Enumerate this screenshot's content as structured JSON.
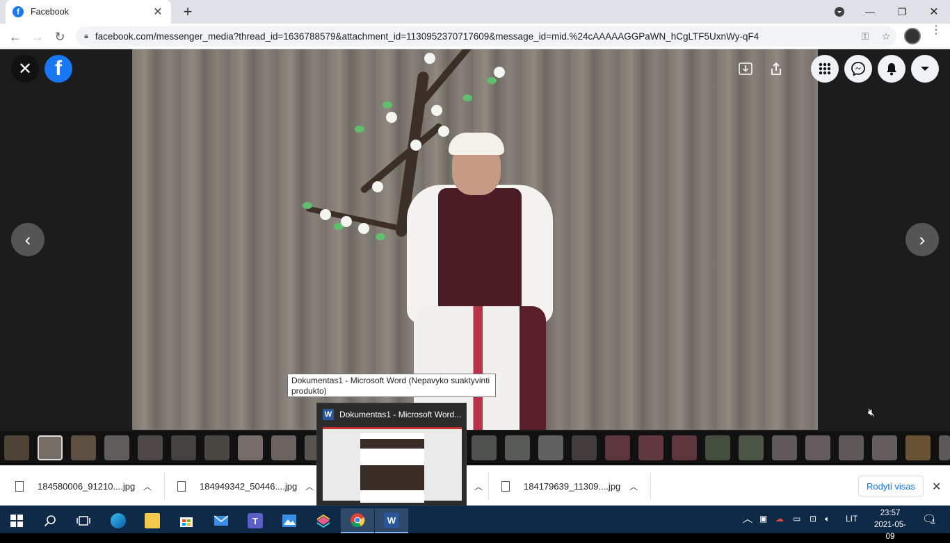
{
  "browser": {
    "tab_title": "Facebook",
    "tab_favicon": "f",
    "new_tab_symbol": "+",
    "url": "facebook.com/messenger_media?thread_id=1636788579&attachment_id=1130952370717609&message_id=mid.%24cAAAAAGGPaWN_hCgLTF5UxnWy-qF4"
  },
  "viewer": {
    "logo_letter": "f",
    "close_symbol": "✕",
    "prev_symbol": "‹",
    "next_symbol": "›"
  },
  "tooltip": {
    "text": "Dokumentas1 - Microsoft Word (Nepavyko suaktyvinti produkto)"
  },
  "preview": {
    "app_letter": "W",
    "title": "Dokumentas1 - Microsoft Word..."
  },
  "downloads": {
    "items": [
      {
        "name": "184580006_91210....jpg"
      },
      {
        "name": "184949342_50446....jpg"
      },
      {
        "name": "184179639_11309....jpg"
      }
    ],
    "show_all": "Rodyti visas"
  },
  "taskbar": {
    "language": "LIT",
    "time": "23:57",
    "date": "2021-05-09",
    "notification_count": "1"
  },
  "colors": {
    "facebook_blue": "#1877f2",
    "taskbar_bg": "#0e2a47",
    "link_blue": "#1a73e8"
  }
}
